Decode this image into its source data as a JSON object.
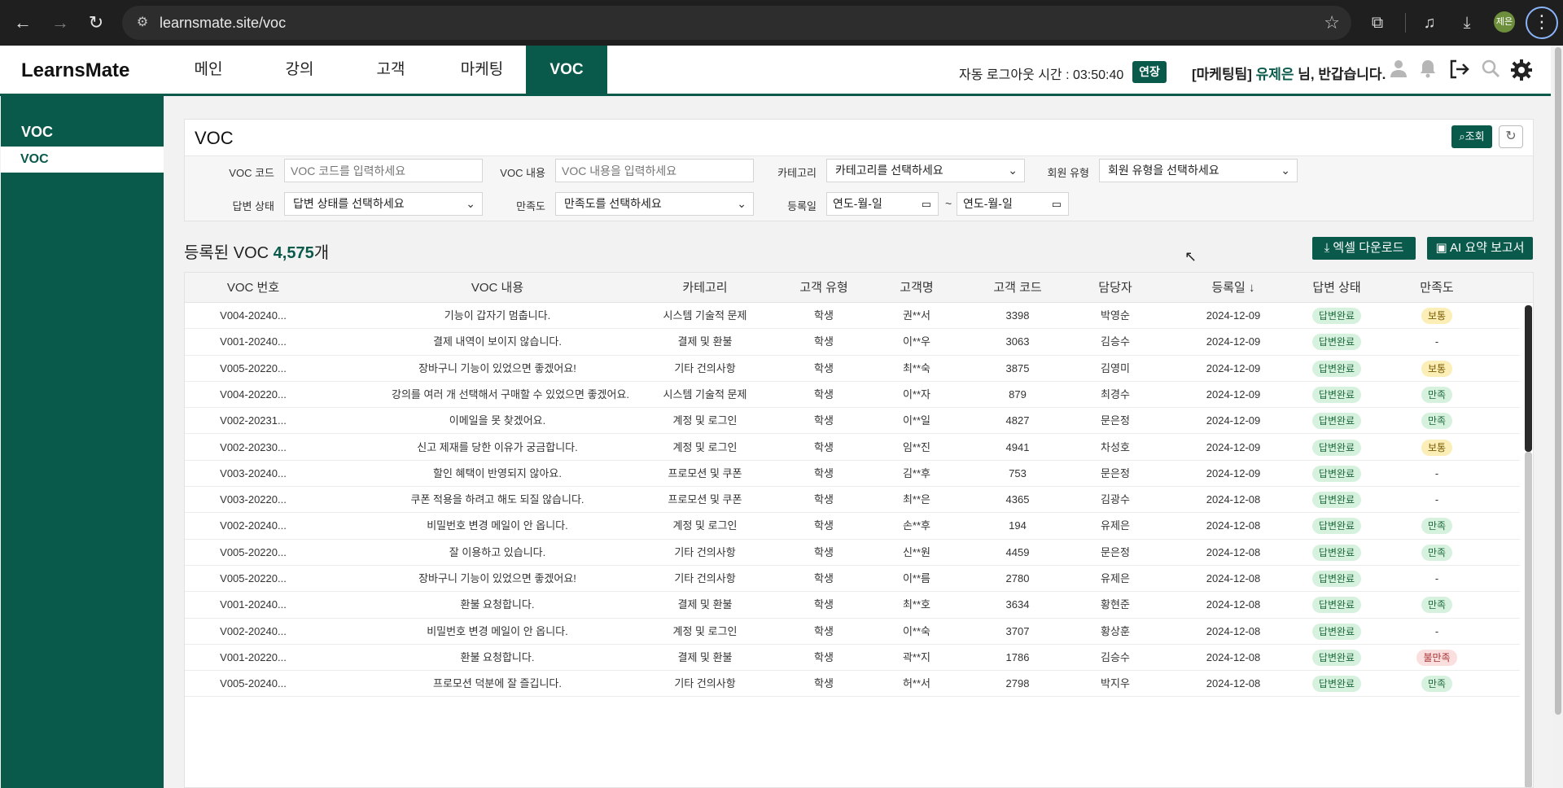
{
  "browser": {
    "url": "learnsmate.site/voc",
    "profile_label": "제은"
  },
  "header": {
    "logo": "LearnsMate",
    "nav": [
      "메인",
      "강의",
      "고객",
      "마케팅",
      "VOC"
    ],
    "active_tab": "VOC",
    "auto_logout": "자동 로그아웃 시간 : 03:50:40",
    "extend_label": "연장",
    "greeting_team": "[마케팅팀]",
    "greeting_user": "유제은",
    "greeting_suffix": "님, 반갑습니다."
  },
  "sidebar": {
    "title": "VOC",
    "items": [
      "VOC"
    ]
  },
  "filters": {
    "page_title": "VOC",
    "search_label": "조회",
    "voc_code_label": "VOC 코드",
    "voc_code_placeholder": "VOC 코드를 입력하세요",
    "voc_content_label": "VOC 내용",
    "voc_content_placeholder": "VOC 내용을 입력하세요",
    "category_label": "카테고리",
    "category_value": "카테고리를 선택하세요",
    "member_type_label": "회원 유형",
    "member_type_value": "회원 유형을 선택하세요",
    "answer_status_label": "답변 상태",
    "answer_status_value": "답변 상태를 선택하세요",
    "satisfaction_label": "만족도",
    "satisfaction_value": "만족도를 선택하세요",
    "reg_date_label": "등록일",
    "date_from": "연도-월-일",
    "date_to": "연도-월-일",
    "tilde": "~"
  },
  "summary": {
    "prefix": "등록된 VOC ",
    "count": "4,575",
    "suffix": "개",
    "excel_label": "엑셀 다운로드",
    "ai_label": "AI 요약 보고서"
  },
  "table": {
    "columns": [
      "VOC 번호",
      "VOC 내용",
      "카테고리",
      "고객 유형",
      "고객명",
      "고객 코드",
      "담당자",
      "등록일 ↓",
      "답변 상태",
      "만족도"
    ],
    "rows": [
      [
        "V004-20240...",
        "기능이 갑자기 멈춥니다.",
        "시스템 기술적 문제",
        "학생",
        "권**서",
        "3398",
        "박영순",
        "2024-12-09",
        "답변완료",
        "보통"
      ],
      [
        "V001-20240...",
        "결제 내역이 보이지 않습니다.",
        "결제 및 환불",
        "학생",
        "이**우",
        "3063",
        "김승수",
        "2024-12-09",
        "답변완료",
        "-"
      ],
      [
        "V005-20220...",
        "장바구니 기능이 있었으면 좋겠어요!",
        "기타 건의사항",
        "학생",
        "최**숙",
        "3875",
        "김영미",
        "2024-12-09",
        "답변완료",
        "보통"
      ],
      [
        "V004-20220...",
        "강의를 여러 개 선택해서 구매할 수 있었으면 좋겠어요.",
        "시스템 기술적 문제",
        "학생",
        "이**자",
        "879",
        "최경수",
        "2024-12-09",
        "답변완료",
        "만족"
      ],
      [
        "V002-20231...",
        "이메일을 못 찾겠어요.",
        "계정 및 로그인",
        "학생",
        "이**일",
        "4827",
        "문은정",
        "2024-12-09",
        "답변완료",
        "만족"
      ],
      [
        "V002-20230...",
        "신고 제재를 당한 이유가 궁금합니다.",
        "계정 및 로그인",
        "학생",
        "임**진",
        "4941",
        "차성호",
        "2024-12-09",
        "답변완료",
        "보통"
      ],
      [
        "V003-20240...",
        "할인 혜택이 반영되지 않아요.",
        "프로모션 및 쿠폰",
        "학생",
        "김**후",
        "753",
        "문은정",
        "2024-12-09",
        "답변완료",
        "-"
      ],
      [
        "V003-20220...",
        "쿠폰 적용을 하려고 해도 되질 않습니다.",
        "프로모션 및 쿠폰",
        "학생",
        "최**은",
        "4365",
        "김광수",
        "2024-12-08",
        "답변완료",
        "-"
      ],
      [
        "V002-20240...",
        "비밀번호 변경 메일이 안 옵니다.",
        "계정 및 로그인",
        "학생",
        "손**후",
        "194",
        "유제은",
        "2024-12-08",
        "답변완료",
        "만족"
      ],
      [
        "V005-20220...",
        "잘 이용하고 있습니다.",
        "기타 건의사항",
        "학생",
        "신**원",
        "4459",
        "문은정",
        "2024-12-08",
        "답변완료",
        "만족"
      ],
      [
        "V005-20220...",
        "장바구니 기능이 있었으면 좋겠어요!",
        "기타 건의사항",
        "학생",
        "이**름",
        "2780",
        "유제은",
        "2024-12-08",
        "답변완료",
        "-"
      ],
      [
        "V001-20240...",
        "환불 요청합니다.",
        "결제 및 환불",
        "학생",
        "최**호",
        "3634",
        "황현준",
        "2024-12-08",
        "답변완료",
        "만족"
      ],
      [
        "V002-20240...",
        "비밀번호 변경 메일이 안 옵니다.",
        "계정 및 로그인",
        "학생",
        "이**숙",
        "3707",
        "황상훈",
        "2024-12-08",
        "답변완료",
        "-"
      ],
      [
        "V001-20220...",
        "환불 요청합니다.",
        "결제 및 환불",
        "학생",
        "곽**지",
        "1786",
        "김승수",
        "2024-12-08",
        "답변완료",
        "불만족"
      ],
      [
        "V005-20240...",
        "프로모션 덕분에 잘 즐깁니다.",
        "기타 건의사항",
        "학생",
        "허**서",
        "2798",
        "박지우",
        "2024-12-08",
        "답변완료",
        "만족"
      ]
    ]
  },
  "colors": {
    "brand": "#0a5a4c",
    "badge_green": "#d7f1df",
    "badge_yellow": "#fbeeb7",
    "badge_red": "#fbdede"
  }
}
